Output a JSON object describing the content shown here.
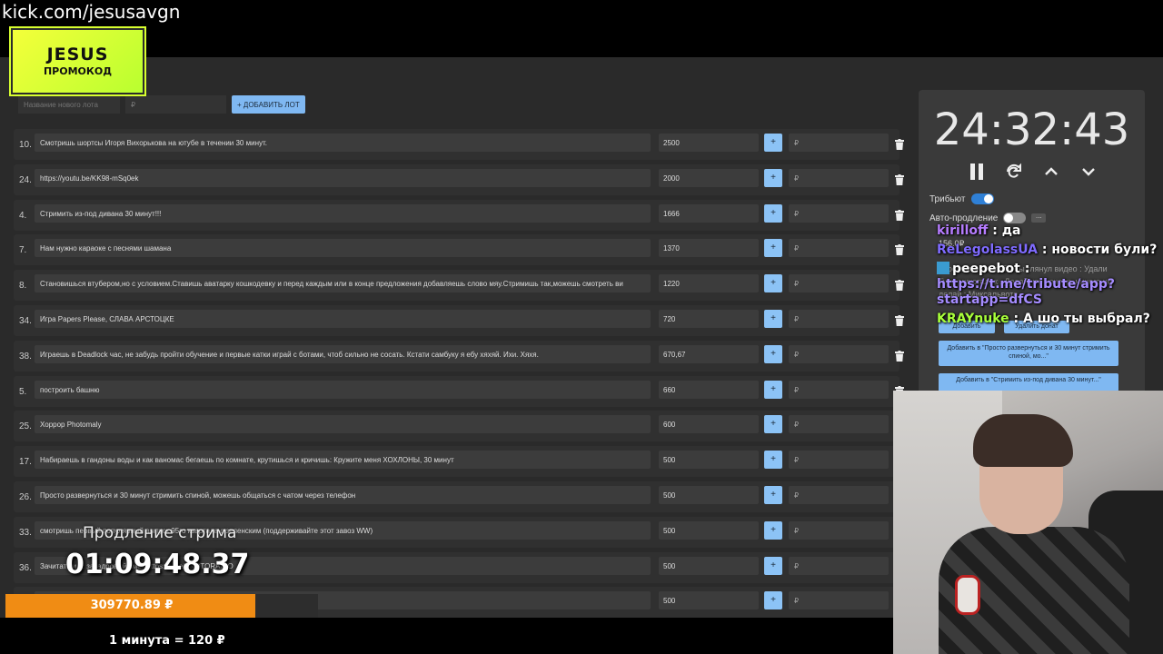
{
  "overlay": {
    "channel_url": "kick.com/jesusavgn",
    "promo_line1": "JESUS",
    "promo_line2": "ПРОМОКОД"
  },
  "add_lot": {
    "name_placeholder": "Название нового лота",
    "price_placeholder": "₽",
    "add_button": "+ ДОБАВИТЬ ЛОТ"
  },
  "colors": {
    "accent": "#8cc3f6",
    "toggle_on": "#2f80d6",
    "progress": "#f08c14"
  },
  "lots": [
    {
      "num": "10.",
      "title": "Смотришь шортсы Игоря Вихорькова на ютубе в течении 30 минут.",
      "amount": "2500",
      "plus": "+",
      "rub": "₽"
    },
    {
      "num": "24.",
      "title": "https://youtu.be/KK98-mSq0ek",
      "amount": "2000",
      "plus": "+",
      "rub": "₽"
    },
    {
      "num": "4.",
      "title": "Стримить из-под дивана 30 минут!!!",
      "amount": "1666",
      "plus": "+",
      "rub": "₽"
    },
    {
      "num": "7.",
      "title": "Нам нужно караоке с песнями шамана",
      "amount": "1370",
      "plus": "+",
      "rub": "₽"
    },
    {
      "num": "8.",
      "title": "Становишься втубером,но с условием.Ставишь аватарку кошкодевку и перед каждым или в конце предложения добавляешь слово мяу.Стримишь так,можешь смотреть ви",
      "amount": "1220",
      "plus": "+",
      "rub": "₽"
    },
    {
      "num": "34.",
      "title": "Игра Papers Please, СЛАВА АРСТОЦКЕ",
      "amount": "720",
      "plus": "+",
      "rub": "₽"
    },
    {
      "num": "38.",
      "title": "Играешь в Deadlock час, не забудь пройти обучение и первые катки играй с ботами, чтоб сильно не сосать. Кстати самбуку я ебу хяхяй. Ихи. Хяхя.",
      "amount": "670,67",
      "plus": "+",
      "rub": "₽"
    },
    {
      "num": "5.",
      "title": "построить башню",
      "amount": "660",
      "plus": "+",
      "rub": "₽"
    },
    {
      "num": "25.",
      "title": "Хоррор Photomaly",
      "amount": "600",
      "plus": "+",
      "rub": "₽"
    },
    {
      "num": "17.",
      "title": "Набираешь в гандоны воды и как ваномас бегаешь по комнате, крутишься и кричишь: Кружите меня ХОХЛОНЫ, 30 минут",
      "amount": "500",
      "plus": "+",
      "rub": "₽"
    },
    {
      "num": "26.",
      "title": "Просто развернуться и 30 минут стримить спиной, можешь общаться с чатом через телефон",
      "amount": "500",
      "plus": "+",
      "rub": "₽"
    },
    {
      "num": "33.",
      "title": "смотришь первый популярный выпуск 95го квартала с зеленским (поддерживайте этот завоз WW)",
      "amount": "500",
      "plus": "+",
      "rub": "₽"
    },
    {
      "num": "36.",
      "title": "Зачитать и ... закадровый смех https://t.me/SKOTORADIO",
      "amount": "500",
      "plus": "+",
      "rub": "₽"
    },
    {
      "num": "",
      "title": "",
      "amount": "500",
      "plus": "+",
      "rub": "₽"
    }
  ],
  "timer": {
    "time": "24:32:43",
    "tribute_label": "Трибьют",
    "tribute_on": true,
    "autoextend_label": "Авто-продление",
    "autoextend_on": false,
    "more": "..."
  },
  "donations": {
    "amount": "156.0₽",
    "text": "просто скину чтобы ты глянул видео : Удали Тупи миксталик . Делай что хочешь ничего не делай : Миксальвота",
    "btn_add": "Добавить",
    "btn_delete": "Удалить донат",
    "item1": "Добавить в \"Просто развернуться и 30 минут стримить спиной, мо...\"",
    "item2": "Добавить в \"Стримить из-под дивана 30 минут...\""
  },
  "chat": [
    {
      "user": "kirilloff",
      "color": "#b67cff",
      "text": "да"
    },
    {
      "user": "ReLegolassUA",
      "color": "#7f6bff",
      "text": "новости були?"
    },
    {
      "user": "peepebot",
      "color": "#ffffff",
      "text": "https://t.me/tribute/app?startapp=dfCS",
      "text_color": "#a58cff",
      "emote": true
    },
    {
      "user": "KRAYnuke",
      "color": "#a8ff3a",
      "text": "А шо ты выбрал?"
    }
  ],
  "extension": {
    "label": "Продление стрима",
    "time": "01:09:48.37",
    "total": "309770.89 ₽",
    "progress_fraction": 0.8,
    "rate": "1 минута = 120 ₽"
  }
}
